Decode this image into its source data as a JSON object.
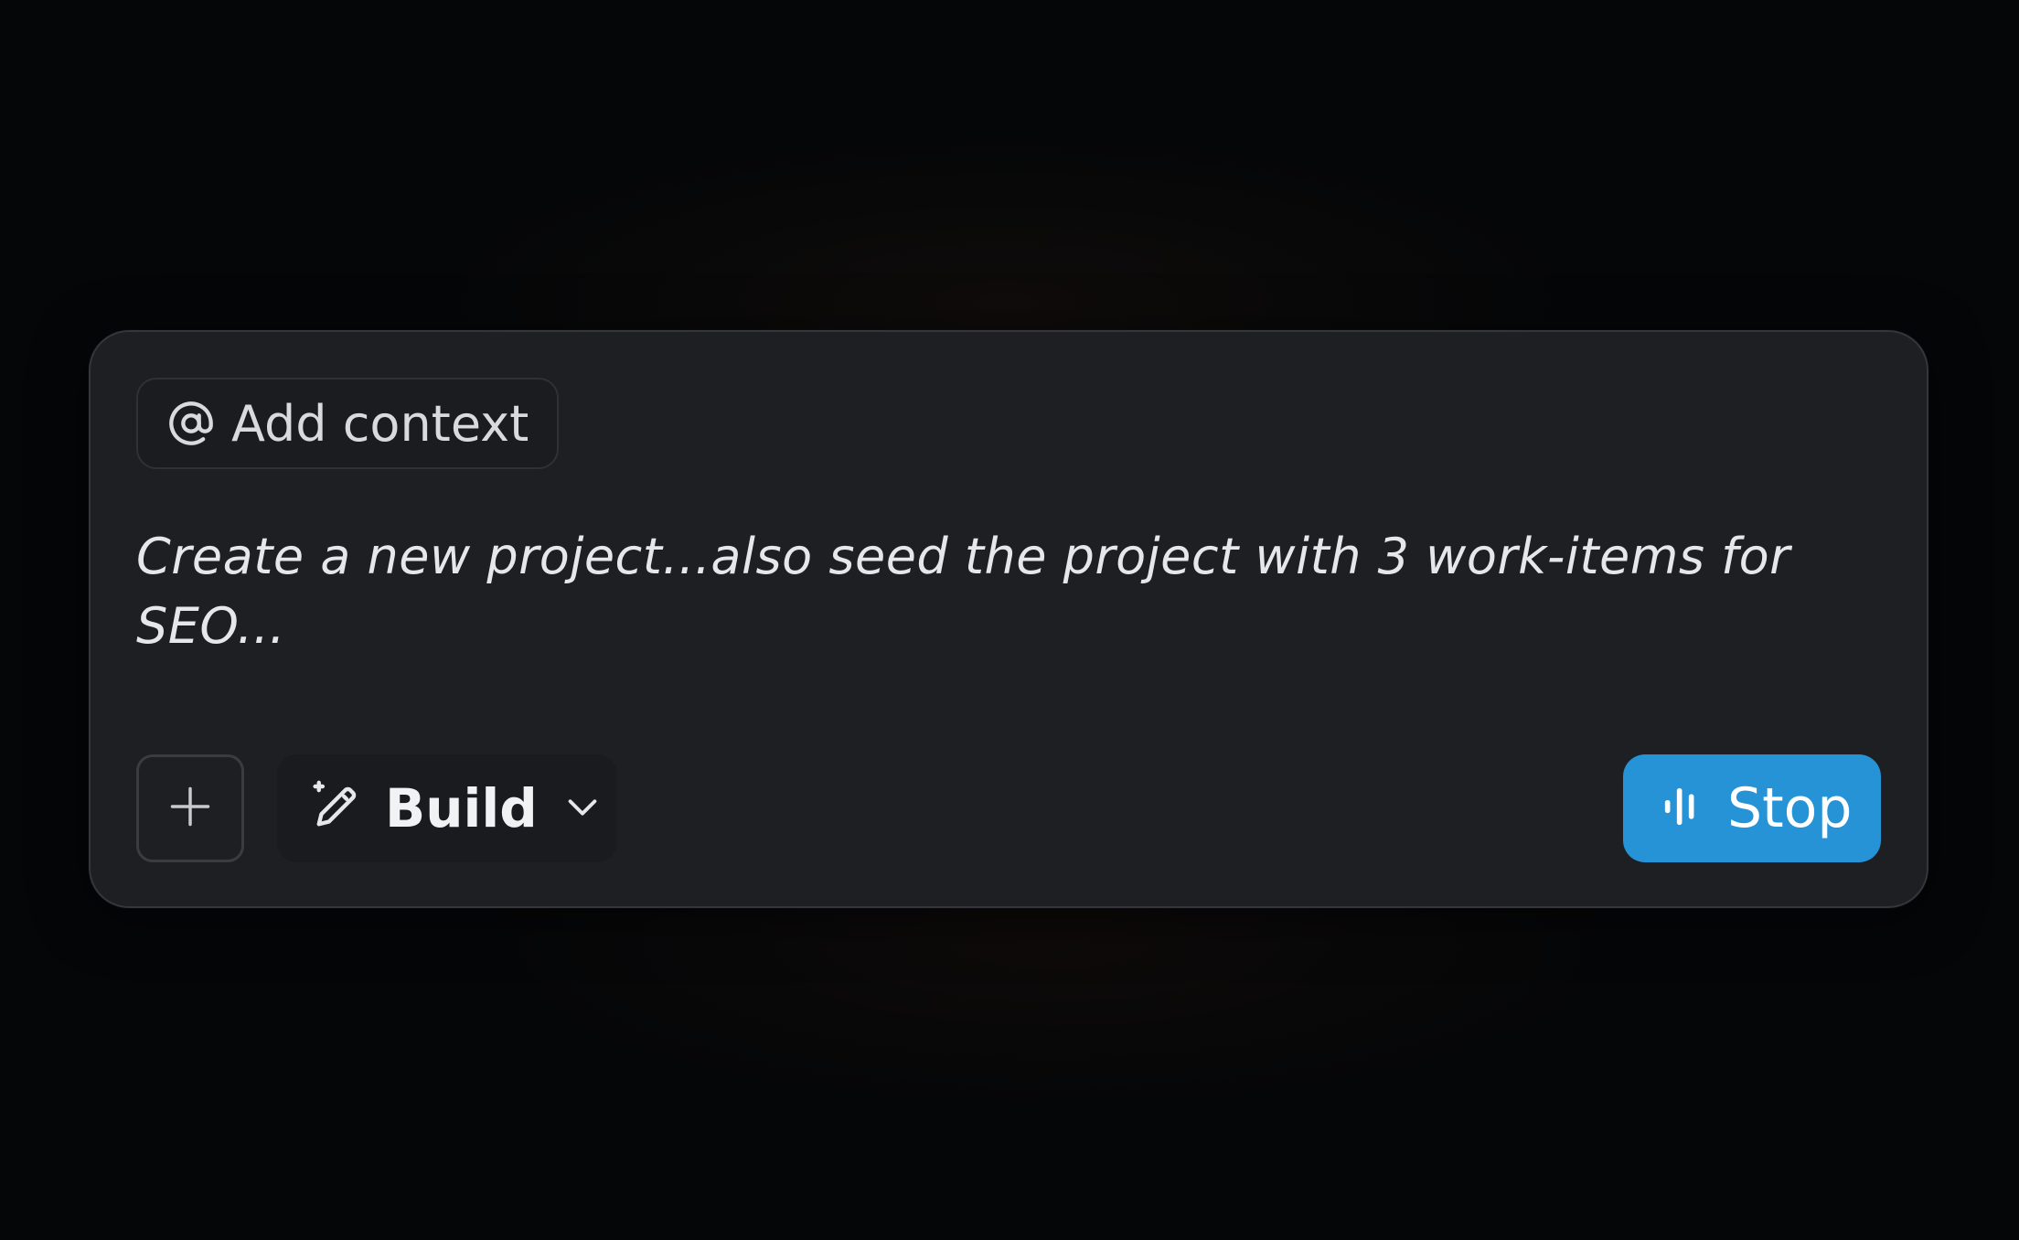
{
  "composer": {
    "add_context_label": "Add context",
    "prompt_text": "Create a new project...also seed the project with 3 work-items for SEO...",
    "mode_label": "Build",
    "stop_label": "Stop"
  },
  "icons": {
    "add_context": "at-icon",
    "attach": "plus-icon",
    "mode": "magic-pencil-icon",
    "mode_dropdown": "chevron-down-icon",
    "stop": "audio-wave-icon"
  },
  "colors": {
    "background": "#050608",
    "panel": "#1e1f22",
    "accent": "#2593d6",
    "text": "#e6e7ea"
  }
}
